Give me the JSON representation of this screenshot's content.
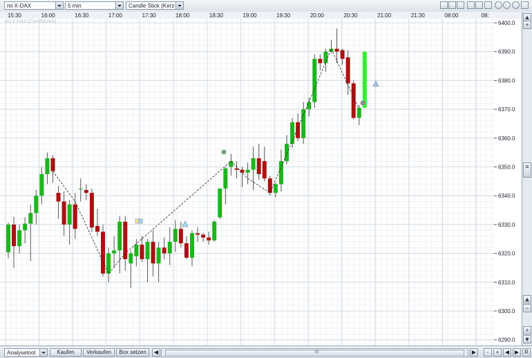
{
  "toolbar": {
    "instrument": "mi X-DAX",
    "interval": "5 min",
    "chart_type": "Candle Stick (Kerze"
  },
  "chart": {
    "subtitle": "mi X-DAX (Candlestick)",
    "time_labels": [
      "15:30",
      "16:00",
      "16:30",
      "17:00",
      "17:30",
      "18:00",
      "18:30",
      "19:00",
      "19:30",
      "20:00",
      "20:30",
      "21:00",
      "21:30",
      "08:00",
      "08:"
    ],
    "price_labels": [
      "6400.0",
      "6390.0",
      "6380.0",
      "6370.0",
      "6360.0",
      "6350.0",
      "6340.0",
      "6330.0",
      "6320.0",
      "6310.0",
      "6300.0",
      "6290.0"
    ],
    "up_color": "#1db51d",
    "down_color": "#aa1111",
    "live_color": "#33ee33"
  },
  "chart_data": {
    "type": "candlestick",
    "subtitle": "mi X-DAX (Candlestick)",
    "interval": "5 min",
    "ylim": [
      6288,
      6403
    ],
    "y_ticks": [
      6290,
      6300,
      6310,
      6320,
      6330,
      6340,
      6350,
      6360,
      6370,
      6380,
      6390,
      6400
    ],
    "x_ticks": [
      "15:30",
      "16:00",
      "16:30",
      "17:00",
      "17:30",
      "18:00",
      "18:30",
      "19:00",
      "19:30",
      "20:00",
      "20:30",
      "21:00",
      "21:30",
      "08:00",
      "08:"
    ],
    "grid": true,
    "candles": [
      {
        "o": 6320.4,
        "h": 6330.7,
        "l": 6318.3,
        "c": 6330.0
      },
      {
        "o": 6330.0,
        "h": 6332.7,
        "l": 6315.0,
        "c": 6322.5
      },
      {
        "o": 6322.5,
        "h": 6330.0,
        "l": 6320.0,
        "c": 6328.0
      },
      {
        "o": 6328.0,
        "h": 6332.5,
        "l": 6323.5,
        "c": 6330.3
      },
      {
        "o": 6330.3,
        "h": 6337.0,
        "l": 6317.3,
        "c": 6334.0
      },
      {
        "o": 6334.0,
        "h": 6342.0,
        "l": 6330.0,
        "c": 6340.0
      },
      {
        "o": 6340.0,
        "h": 6350.0,
        "l": 6337.0,
        "c": 6347.5
      },
      {
        "o": 6347.5,
        "h": 6355.0,
        "l": 6344.0,
        "c": 6353.0
      },
      {
        "o": 6353.0,
        "h": 6354.0,
        "l": 6344.5,
        "c": 6348.5
      },
      {
        "o": 6341.0,
        "h": 6343.5,
        "l": 6332.0,
        "c": 6338.0
      },
      {
        "o": 6338.0,
        "h": 6341.5,
        "l": 6326.0,
        "c": 6330.0
      },
      {
        "o": 6330.0,
        "h": 6338.5,
        "l": 6323.0,
        "c": 6337.0
      },
      {
        "o": 6337.0,
        "h": 6341.0,
        "l": 6325.0,
        "c": 6328.5
      },
      {
        "o": 6342.5,
        "h": 6346.0,
        "l": 6338.0,
        "c": 6342.5
      },
      {
        "o": 6342.0,
        "h": 6344.0,
        "l": 6338.5,
        "c": 6341.0
      },
      {
        "o": 6341.0,
        "h": 6342.5,
        "l": 6327.5,
        "c": 6329.0
      },
      {
        "o": 6329.5,
        "h": 6335.5,
        "l": 6326.0,
        "c": 6327.5
      },
      {
        "o": 6327.5,
        "h": 6330.0,
        "l": 6312.0,
        "c": 6313.0
      },
      {
        "o": 6313.0,
        "h": 6322.0,
        "l": 6310.0,
        "c": 6320.0
      },
      {
        "o": 6320.0,
        "h": 6326.0,
        "l": 6315.0,
        "c": 6321.0
      },
      {
        "o": 6321.0,
        "h": 6333.0,
        "l": 6313.0,
        "c": 6331.0
      },
      {
        "o": 6331.0,
        "h": 6333.0,
        "l": 6314.0,
        "c": 6318.0
      },
      {
        "o": 6316.5,
        "h": 6321.0,
        "l": 6308.0,
        "c": 6320.0
      },
      {
        "o": 6319.0,
        "h": 6325.0,
        "l": 6315.5,
        "c": 6323.0
      },
      {
        "o": 6323.0,
        "h": 6326.0,
        "l": 6317.0,
        "c": 6318.0
      },
      {
        "o": 6318.0,
        "h": 6325.0,
        "l": 6310.0,
        "c": 6324.0
      },
      {
        "o": 6324.0,
        "h": 6328.0,
        "l": 6312.0,
        "c": 6316.5
      },
      {
        "o": 6316.5,
        "h": 6324.0,
        "l": 6310.0,
        "c": 6322.0
      },
      {
        "o": 6322.0,
        "h": 6325.5,
        "l": 6318.0,
        "c": 6320.0
      },
      {
        "o": 6320.0,
        "h": 6329.0,
        "l": 6316.0,
        "c": 6324.0
      },
      {
        "o": 6324.0,
        "h": 6331.5,
        "l": 6320.5,
        "c": 6328.5
      },
      {
        "o": 6328.5,
        "h": 6331.0,
        "l": 6322.0,
        "c": 6323.5
      },
      {
        "o": 6323.5,
        "h": 6326.0,
        "l": 6318.0,
        "c": 6318.5
      },
      {
        "o": 6318.5,
        "h": 6328.0,
        "l": 6315.5,
        "c": 6327.0
      },
      {
        "o": 6327.0,
        "h": 6329.0,
        "l": 6324.0,
        "c": 6326.5
      },
      {
        "o": 6326.5,
        "h": 6327.0,
        "l": 6324.0,
        "c": 6325.5
      },
      {
        "o": 6325.5,
        "h": 6327.5,
        "l": 6323.0,
        "c": 6324.5
      },
      {
        "o": 6324.5,
        "h": 6331.5,
        "l": 6324.0,
        "c": 6331.0
      },
      {
        "o": 6332.5,
        "h": 6338.0,
        "l": 6332.0,
        "c": 6342.5
      },
      {
        "o": 6342.5,
        "h": 6350.0,
        "l": 6337.0,
        "c": 6349.5
      },
      {
        "o": 6350.0,
        "h": 6354.5,
        "l": 6347.0,
        "c": 6352.0
      },
      {
        "o": 6349.5,
        "h": 6352.0,
        "l": 6346.0,
        "c": 6349.0
      },
      {
        "o": 6349.0,
        "h": 6350.0,
        "l": 6343.0,
        "c": 6348.0
      },
      {
        "o": 6348.0,
        "h": 6351.5,
        "l": 6344.0,
        "c": 6349.0
      },
      {
        "o": 6349.0,
        "h": 6357.0,
        "l": 6342.0,
        "c": 6353.0
      },
      {
        "o": 6353.0,
        "h": 6358.0,
        "l": 6345.5,
        "c": 6347.5
      },
      {
        "o": 6352.0,
        "h": 6357.0,
        "l": 6345.0,
        "c": 6346.0
      },
      {
        "o": 6346.0,
        "h": 6347.0,
        "l": 6340.0,
        "c": 6341.0
      },
      {
        "o": 6341.0,
        "h": 6344.5,
        "l": 6339.5,
        "c": 6344.0
      },
      {
        "o": 6344.0,
        "h": 6356.0,
        "l": 6341.5,
        "c": 6352.0
      },
      {
        "o": 6352.0,
        "h": 6361.0,
        "l": 6351.0,
        "c": 6358.0
      },
      {
        "o": 6358.0,
        "h": 6367.0,
        "l": 6356.5,
        "c": 6365.5
      },
      {
        "o": 6365.5,
        "h": 6368.5,
        "l": 6359.0,
        "c": 6360.0
      },
      {
        "o": 6360.0,
        "h": 6372.5,
        "l": 6358.0,
        "c": 6370.0
      },
      {
        "o": 6370.0,
        "h": 6374.0,
        "l": 6367.5,
        "c": 6372.5
      },
      {
        "o": 6372.5,
        "h": 6389.0,
        "l": 6370.5,
        "c": 6387.5
      },
      {
        "o": 6387.5,
        "h": 6389.0,
        "l": 6383.5,
        "c": 6386.0
      },
      {
        "o": 6386.0,
        "h": 6391.0,
        "l": 6383.0,
        "c": 6390.0
      },
      {
        "o": 6390.0,
        "h": 6394.0,
        "l": 6389.5,
        "c": 6391.0
      },
      {
        "o": 6391.0,
        "h": 6398.0,
        "l": 6386.0,
        "c": 6390.0
      },
      {
        "o": 6390.5,
        "h": 6391.0,
        "l": 6385.5,
        "c": 6387.5
      },
      {
        "o": 6388.0,
        "h": 6390.5,
        "l": 6375.0,
        "c": 6379.0
      },
      {
        "o": 6379.0,
        "h": 6380.0,
        "l": 6366.5,
        "c": 6367.0
      },
      {
        "o": 6367.0,
        "h": 6371.5,
        "l": 6364.5,
        "c": 6370.5
      },
      {
        "o": 6370.5,
        "h": 6390.0,
        "l": 6370.5,
        "c": 6390.0
      }
    ],
    "trend_line": [
      6348.5,
      6338.0,
      6313.0,
      6320.0,
      6352.0,
      6346.0,
      6341.0,
      6372.5,
      6391.0,
      6370.0
    ]
  },
  "bottom": {
    "tool": "Analysetool",
    "buy": "Kaufen",
    "sell": "Verkaufen",
    "box": "Box setzen",
    "scroll_grip": "III",
    "nav_minus": "-",
    "nav_plus": "+",
    "reset": "R"
  }
}
